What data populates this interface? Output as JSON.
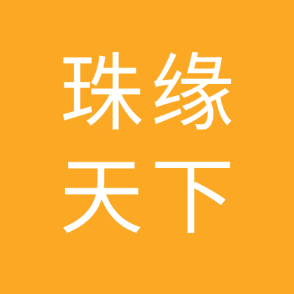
{
  "logo": {
    "line1": "珠缘",
    "line2": "天下",
    "background_color": "#FBA824",
    "text_color": "#FFFFFF"
  }
}
